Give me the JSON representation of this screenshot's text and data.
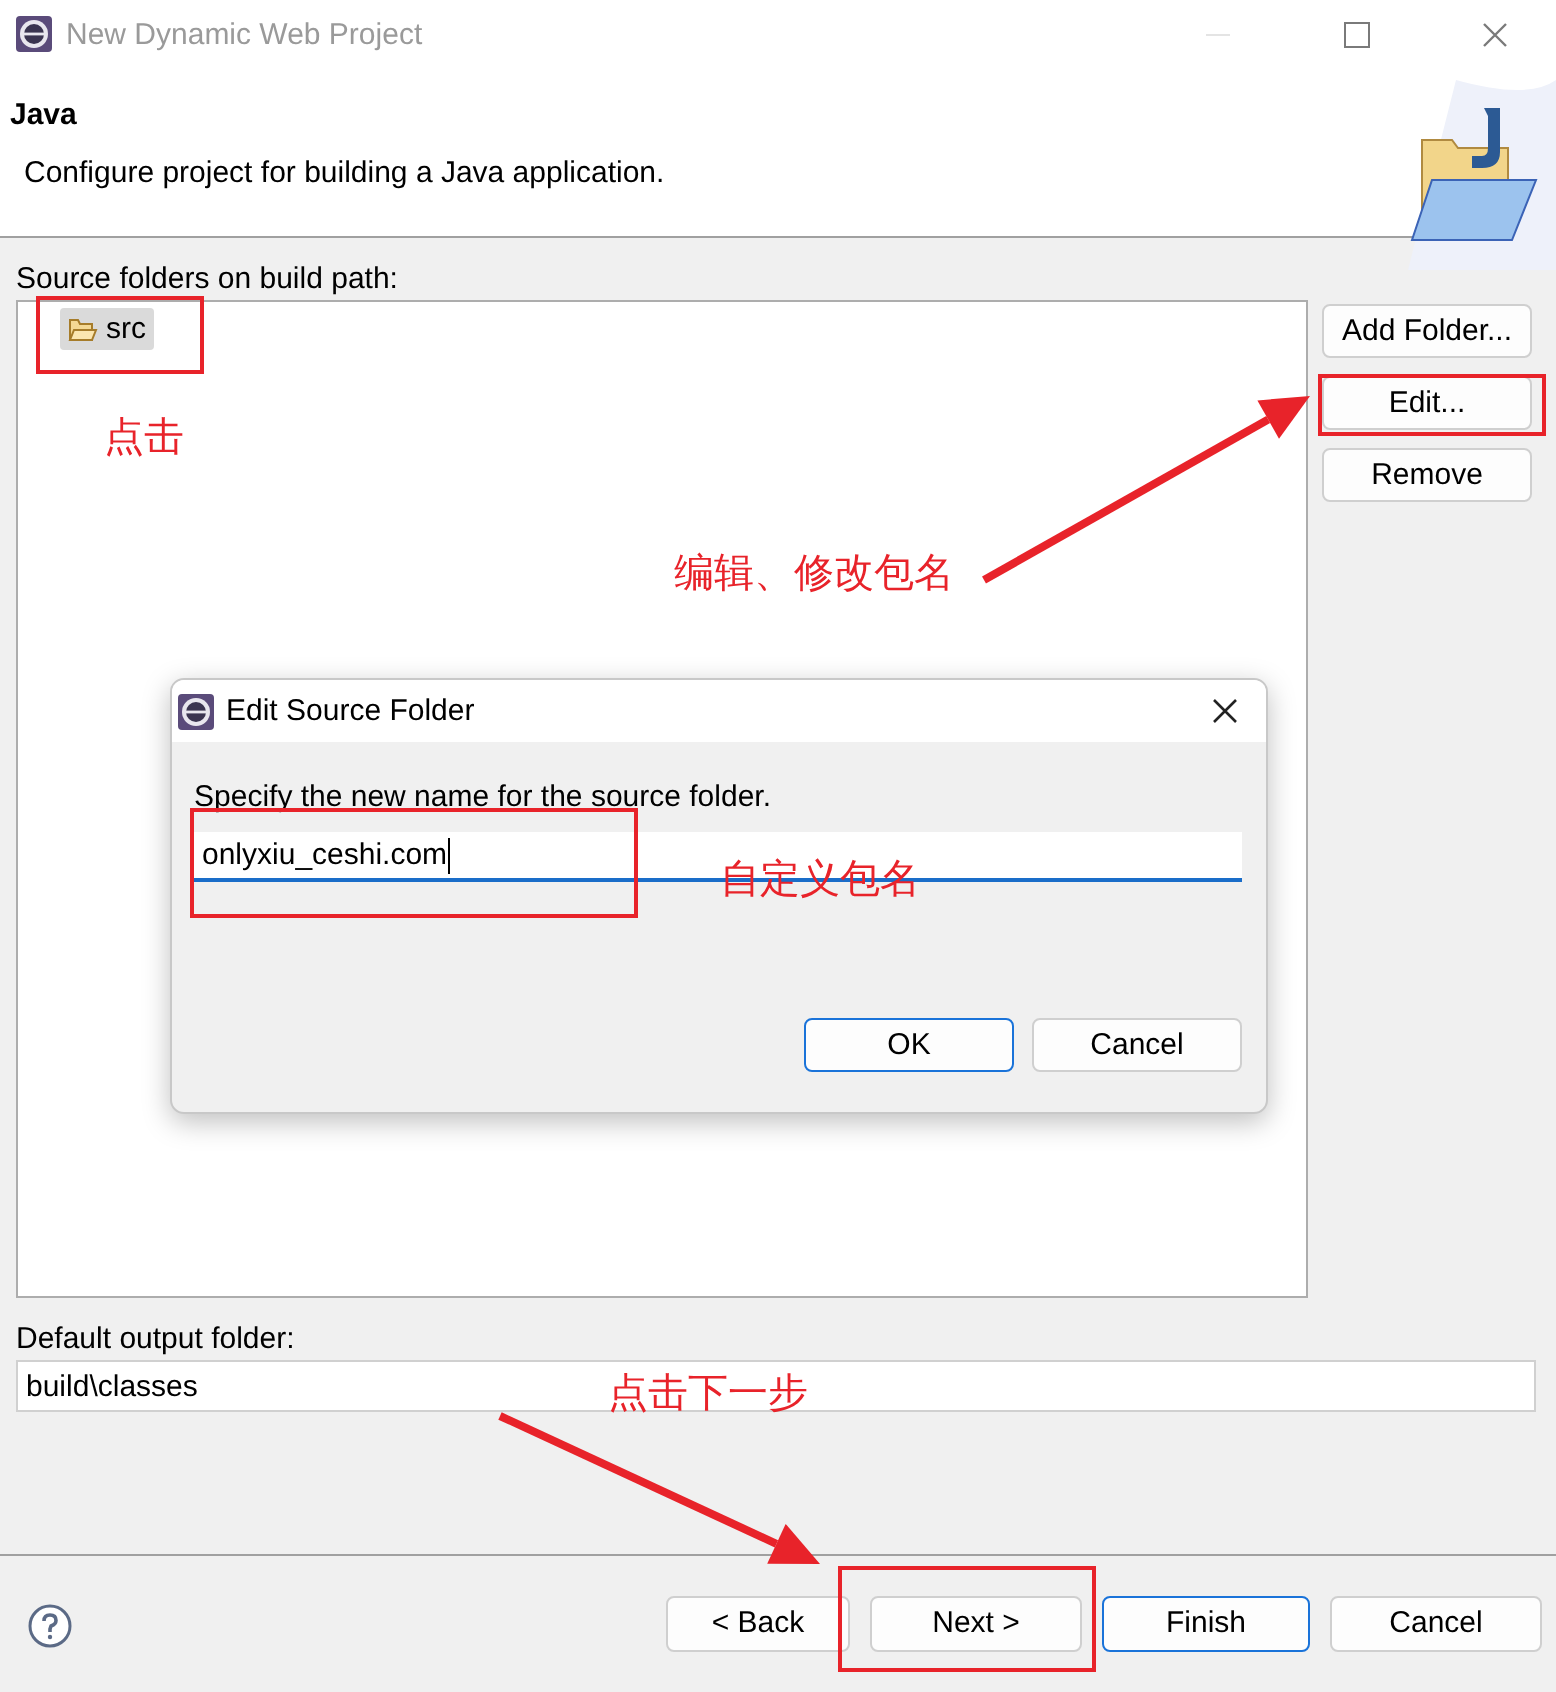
{
  "window": {
    "title": "New Dynamic Web Project"
  },
  "header": {
    "title": "Java",
    "description": "Configure project for building a Java application."
  },
  "source_label": "Source folders on build path:",
  "source_folders": [
    {
      "label": "src",
      "selected": true
    }
  ],
  "side_buttons": [
    {
      "label": "Add Folder..."
    },
    {
      "label": "Edit..."
    },
    {
      "label": "Remove"
    }
  ],
  "output_label": "Default output folder:",
  "output_value": "build\\classes",
  "footer_buttons": [
    {
      "label": "< Back",
      "default": false
    },
    {
      "label": "Next >",
      "default": false
    },
    {
      "label": "Finish",
      "default": true
    },
    {
      "label": "Cancel",
      "default": false
    }
  ],
  "dialog": {
    "title": "Edit Source Folder",
    "prompt": "Specify the new name for the source folder.",
    "value": "onlyxiu_ceshi.com",
    "buttons": [
      {
        "label": "OK",
        "default": true
      },
      {
        "label": "Cancel",
        "default": false
      }
    ]
  },
  "annotations": [
    {
      "text": "点击"
    },
    {
      "text": "编辑、修改包名"
    },
    {
      "text": "自定义包名"
    },
    {
      "text": "点击下一步"
    }
  ]
}
